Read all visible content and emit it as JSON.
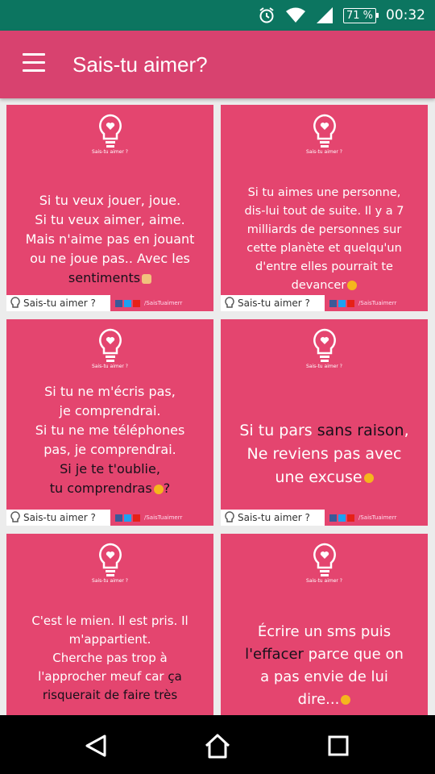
{
  "status": {
    "icons": [
      "alarm-icon",
      "wifi-icon",
      "signal-icon"
    ],
    "battery": "71 %",
    "time": "00:32"
  },
  "app": {
    "title": "Sais-tu aimer?",
    "menu_icon": "hamburger-icon"
  },
  "card_common": {
    "mini_title": "Sais-tu aimer ?",
    "footer_name": "Sais-tu aimer ?",
    "footer_handle": "/SaisTuaimerr"
  },
  "cards": [
    {
      "lines": [
        "Si tu veux jouer, joue.",
        "Si tu veux aimer, aime.",
        "Mais n'aime pas en jouant",
        "ou ne joue pas.. Avec les",
        "sentiments"
      ]
    },
    {
      "lines": [
        "Si tu aimes une personne,",
        "dis-lui tout de suite. Il y a 7",
        "milliards de personnes sur",
        "cette planète et quelqu'un",
        "d'entre elles pourrait te",
        "devancer"
      ]
    },
    {
      "lines": [
        "Si tu ne m'écris pas,",
        "je comprendrai.",
        "Si tu ne me téléphones",
        "pas, je comprendrai.",
        "Si je te t'oublie,",
        "tu comprendras",
        "?"
      ]
    },
    {
      "lines": [
        "Si tu pars",
        "sans raison",
        ",",
        "Ne reviens pas avec",
        "une excuse"
      ]
    },
    {
      "lines": [
        "C'est le mien. Il est pris. Il",
        "m'appartient.",
        "Cherche pas trop à",
        "l'approcher meuf car",
        "ça",
        "risquerait de faire très"
      ]
    },
    {
      "lines": [
        "Écrire un sms puis",
        "l'effacer",
        "parce que on",
        "a pas envie de lui",
        "dire..."
      ]
    }
  ],
  "nav": {
    "back": "back-triangle-icon",
    "home": "home-icon",
    "recents": "recents-square-icon"
  },
  "colors": {
    "status_bar": "#0c7560",
    "app_bar": "#d8426f",
    "card": "#e4456f",
    "highlight_text": "#16101a"
  }
}
